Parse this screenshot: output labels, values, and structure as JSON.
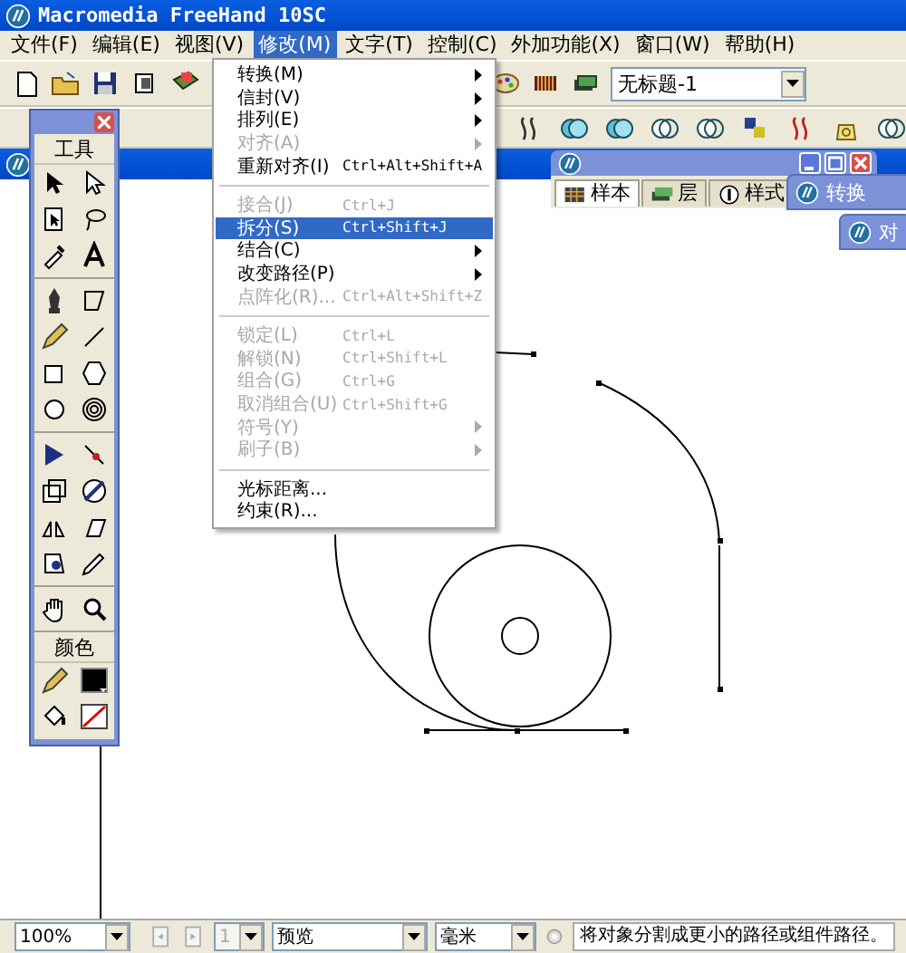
{
  "app_window": {
    "title": "Macromedia FreeHand 10SC"
  },
  "menu_bar": [
    {
      "label": "文件(F)",
      "selected": false
    },
    {
      "label": "编辑(E)",
      "selected": false
    },
    {
      "label": "视图(V)",
      "selected": false
    },
    {
      "label": "修改(M)",
      "selected": true
    },
    {
      "label": "文字(T)",
      "selected": false
    },
    {
      "label": "控制(C)",
      "selected": false
    },
    {
      "label": "外加功能(X)",
      "selected": false
    },
    {
      "label": "窗口(W)",
      "selected": false
    },
    {
      "label": "帮助(H)",
      "selected": false
    }
  ],
  "open_menu": [
    {
      "kind": "item",
      "label": "转换(M)",
      "submenu": true,
      "disabled": false,
      "selected": false
    },
    {
      "kind": "item",
      "label": "信封(V)",
      "submenu": true,
      "disabled": false,
      "selected": false
    },
    {
      "kind": "item",
      "label": "排列(E)",
      "submenu": true,
      "disabled": false,
      "selected": false
    },
    {
      "kind": "item",
      "label": "对齐(A)",
      "submenu": true,
      "disabled": true,
      "selected": false
    },
    {
      "kind": "item",
      "label": "重新对齐(I)",
      "shortcut": "Ctrl+Alt+Shift+A",
      "submenu": false,
      "disabled": false,
      "selected": false
    },
    {
      "kind": "separator"
    },
    {
      "kind": "item",
      "label": "接合(J)",
      "shortcut": "Ctrl+J",
      "submenu": false,
      "disabled": true,
      "selected": false
    },
    {
      "kind": "item",
      "label": "拆分(S)",
      "shortcut": "Ctrl+Shift+J",
      "submenu": false,
      "disabled": false,
      "selected": true
    },
    {
      "kind": "item",
      "label": "结合(C)",
      "submenu": true,
      "disabled": false,
      "selected": false
    },
    {
      "kind": "item",
      "label": "改变路径(P)",
      "submenu": true,
      "disabled": false,
      "selected": false
    },
    {
      "kind": "item",
      "label": "点阵化(R)...",
      "shortcut": "Ctrl+Alt+Shift+Z",
      "submenu": false,
      "disabled": true,
      "selected": false
    },
    {
      "kind": "separator"
    },
    {
      "kind": "item",
      "label": "锁定(L)",
      "shortcut": "Ctrl+L",
      "submenu": false,
      "disabled": true,
      "selected": false
    },
    {
      "kind": "item",
      "label": "解锁(N)",
      "shortcut": "Ctrl+Shift+L",
      "submenu": false,
      "disabled": true,
      "selected": false
    },
    {
      "kind": "item",
      "label": "组合(G)",
      "shortcut": "Ctrl+G",
      "submenu": false,
      "disabled": true,
      "selected": false
    },
    {
      "kind": "item",
      "label": "取消组合(U)",
      "shortcut": "Ctrl+Shift+G",
      "submenu": false,
      "disabled": true,
      "selected": false
    },
    {
      "kind": "item",
      "label": "符号(Y)",
      "submenu": true,
      "disabled": true,
      "selected": false
    },
    {
      "kind": "item",
      "label": "刷子(B)",
      "submenu": true,
      "disabled": true,
      "selected": false
    },
    {
      "kind": "separator"
    },
    {
      "kind": "item",
      "label": "光标距离...",
      "submenu": false,
      "disabled": false,
      "selected": false
    },
    {
      "kind": "item",
      "label": "约束(R)...",
      "submenu": false,
      "disabled": false,
      "selected": false
    }
  ],
  "document_dropdown": {
    "value": "无标题-1"
  },
  "tools_panel": {
    "title": "工具",
    "color_section": "颜色"
  },
  "panel": {
    "tabs": [
      {
        "label": "样本",
        "selected": true
      },
      {
        "label": "层",
        "selected": false
      },
      {
        "label": "样式",
        "selected": false
      }
    ]
  },
  "floating_panels": [
    {
      "title": "转换"
    },
    {
      "title": "对"
    }
  ],
  "status_bar": {
    "zoom": "100%",
    "page": "1",
    "view_mode": "预览",
    "units": "毫米",
    "message": "将对象分割成更小的路径或组件路径。"
  }
}
